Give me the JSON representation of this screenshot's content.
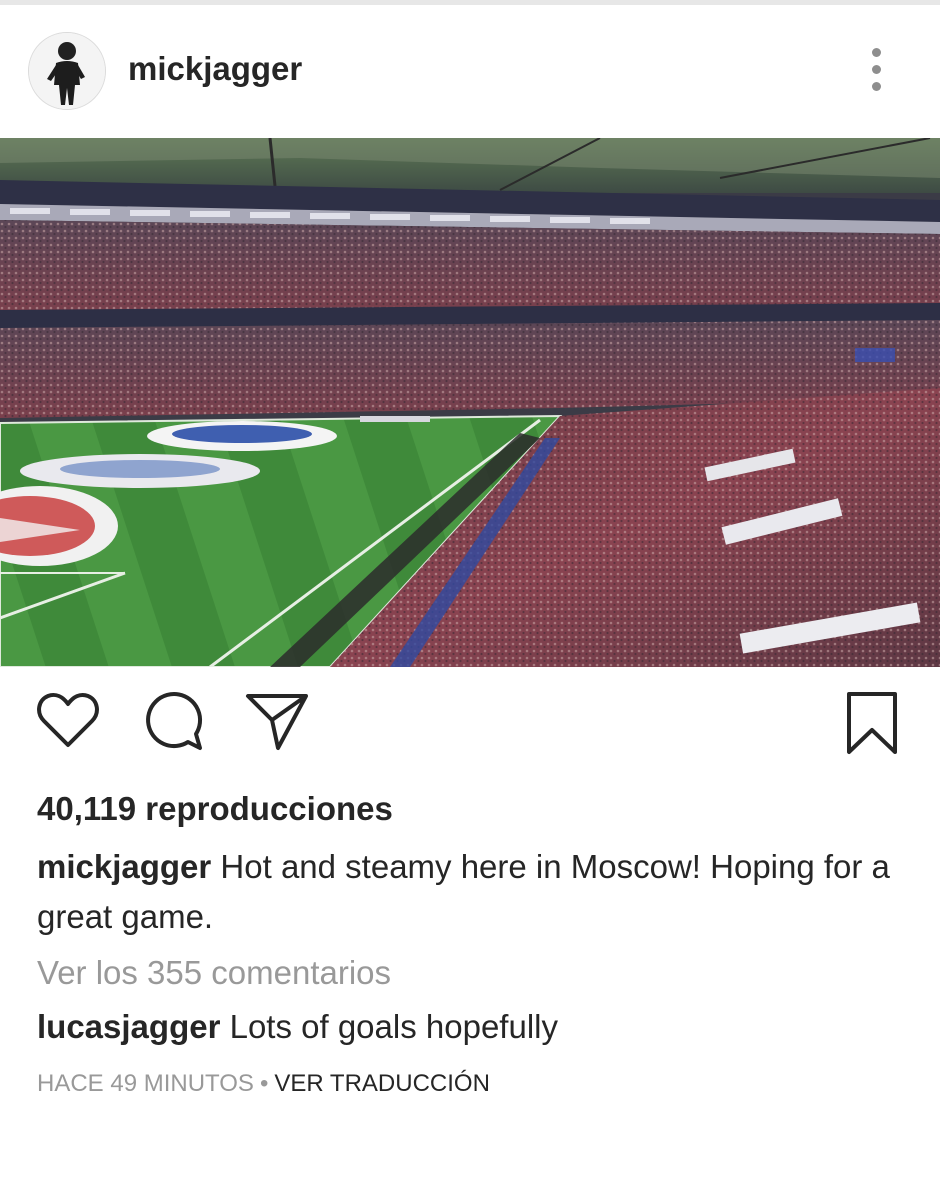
{
  "post": {
    "username": "mickjagger",
    "views": "40,119 reproducciones",
    "caption_user": "mickjagger",
    "caption_text": "Hot and steamy here in Moscow! Hoping for a great game.",
    "view_comments": "Ver los 355 comentarios",
    "comment": {
      "user": "lucasjagger",
      "text": "Lots of goals hopefully"
    },
    "time": "HACE 49 MINUTOS",
    "separator": "•",
    "translate": "VER TRADUCCIÓN"
  },
  "icons": {
    "more": "more-vertical-icon",
    "like": "heart-icon",
    "comment": "comment-bubble-icon",
    "share": "send-paper-plane-icon",
    "save": "bookmark-icon"
  },
  "colors": {
    "text": "#262626",
    "muted": "#999999",
    "pitch": "#3f8a3a",
    "crowd": "#6e3b4a"
  }
}
